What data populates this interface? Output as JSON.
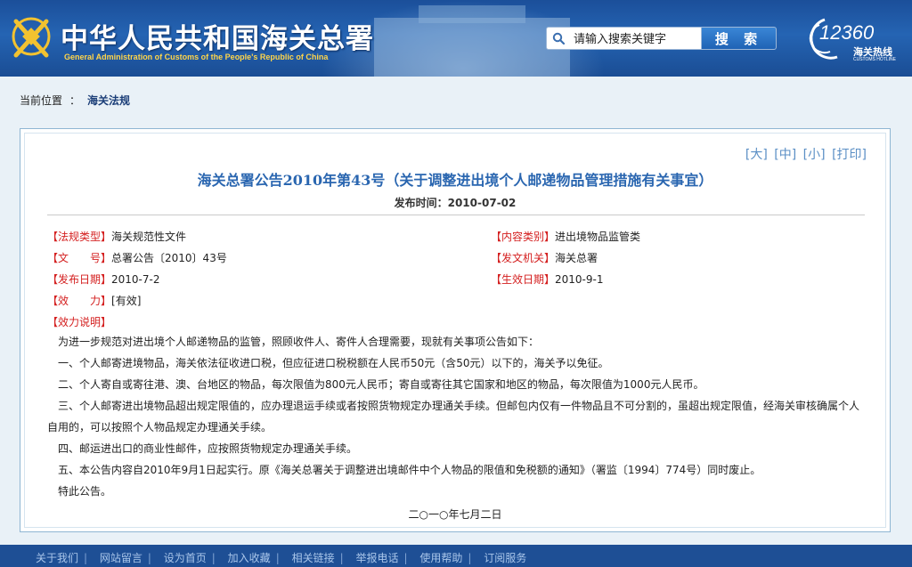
{
  "header": {
    "title_cn": "中华人民共和国海关总署",
    "title_en": "General Administration of Customs of the People's Republic of China",
    "search_placeholder": "请输入搜索关键字",
    "search_button": "搜 索",
    "hotline_number": "12360",
    "hotline_cn": "海关热线",
    "hotline_en": "CUSTOMS HOTLINE"
  },
  "breadcrumb": {
    "label": "当前位置",
    "separator": "：",
    "current": "海关法规"
  },
  "font_tools": [
    "[大]",
    "[中]",
    "[小]",
    "[打印]"
  ],
  "document": {
    "title": "海关总署公告2010年第43号（关于调整进出境个人邮递物品管理措施有关事宜）",
    "publish_label": "发布时间：2010-07-02",
    "meta": {
      "type_label": "【法规类型】",
      "type_value": "海关规范性文件",
      "category_label": "【内容类别】",
      "category_value": "进出境物品监管类",
      "number_label": "【文　　号】",
      "number_value": "总署公告〔2010〕43号",
      "issuer_label": "【发文机关】",
      "issuer_value": "海关总署",
      "issue_date_label": "【发布日期】",
      "issue_date_value": "2010-7-2",
      "effective_date_label": "【生效日期】",
      "effective_date_value": "2010-9-1",
      "validity_label": "【效　　力】",
      "validity_value": "[有效]",
      "validity_note_label": "【效力说明】"
    },
    "paragraphs": [
      "为进一步规范对进出境个人邮递物品的监管，照顾收件人、寄件人合理需要，现就有关事项公告如下：",
      "一、个人邮寄进境物品，海关依法征收进口税，但应征进口税税额在人民币50元（含50元）以下的，海关予以免征。",
      "二、个人寄自或寄往港、澳、台地区的物品，每次限值为800元人民币；寄自或寄往其它国家和地区的物品，每次限值为1000元人民币。",
      "三、个人邮寄进出境物品超出规定限值的，应办理退运手续或者按照货物规定办理通关手续。但邮包内仅有一件物品且不可分割的，虽超出规定限值，经海关审核确属个人自用的，可以按照个人物品规定办理通关手续。",
      "四、邮运进出口的商业性邮件，应按照货物规定办理通关手续。",
      "五、本公告内容自2010年9月1日起实行。原《海关总署关于调整进出境邮件中个人物品的限值和免税额的通知》（署监〔1994〕774号）同时废止。",
      "特此公告。"
    ],
    "signature_date": "二○一○年七月二日"
  },
  "footer": {
    "links": [
      "关于我们",
      "网站留言",
      "设为首页",
      "加入收藏",
      "相关链接",
      "举报电话",
      "使用帮助",
      "订阅服务"
    ]
  },
  "colors": {
    "header_blue": "#1b4f9a",
    "label_red": "#d41f1f",
    "title_blue": "#2a66b0",
    "footer_blue": "#1e4f95"
  }
}
